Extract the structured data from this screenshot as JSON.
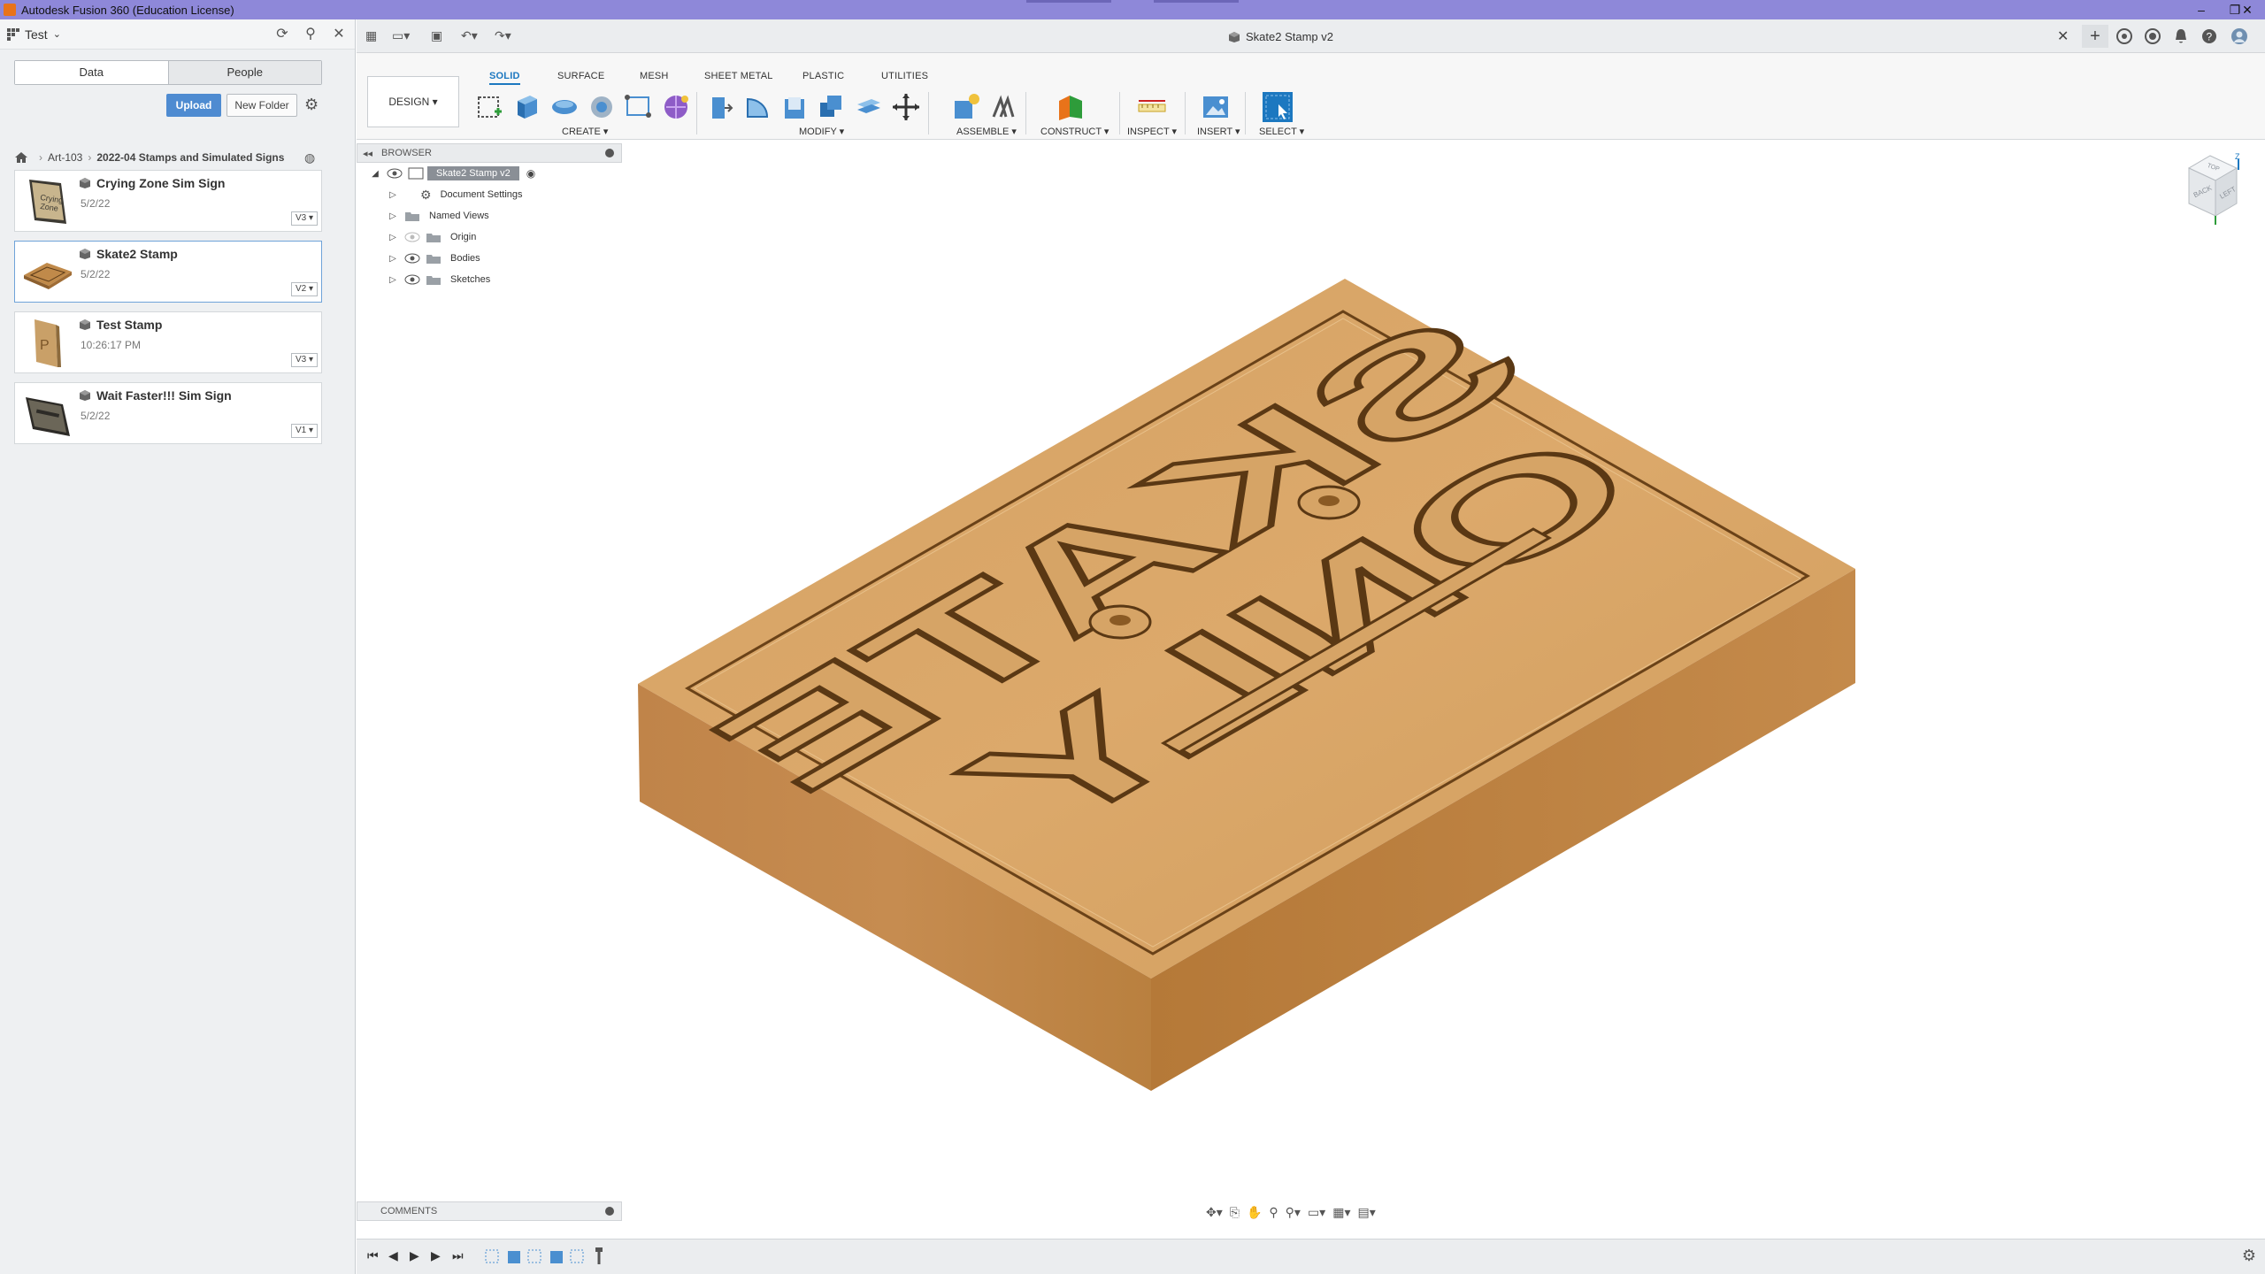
{
  "window": {
    "title": "Autodesk Fusion 360 (Education License)",
    "controls": [
      "–",
      "❐",
      "✕"
    ]
  },
  "data_panel": {
    "project": "Test",
    "tabs": {
      "data": "Data",
      "people": "People"
    },
    "upload_label": "Upload",
    "new_folder_label": "New Folder",
    "breadcrumb": [
      "Art-103",
      "2022-04 Stamps and Simulated Signs"
    ],
    "files": [
      {
        "name": "Crying Zone Sim Sign",
        "date": "5/2/22",
        "version": "V3 ▾"
      },
      {
        "name": "Skate2 Stamp",
        "date": "5/2/22",
        "version": "V2 ▾",
        "selected": true
      },
      {
        "name": "Test Stamp",
        "date": "10:26:17 PM",
        "version": "V3 ▾"
      },
      {
        "name": "Wait Faster!!! Sim Sign",
        "date": "5/2/22",
        "version": "V1 ▾"
      }
    ]
  },
  "document": {
    "tab_title": "Skate2 Stamp v2"
  },
  "ribbon": {
    "workspace": "DESIGN ▾",
    "tabs": [
      "SOLID",
      "SURFACE",
      "MESH",
      "SHEET METAL",
      "PLASTIC",
      "UTILITIES"
    ],
    "active_tab": "SOLID",
    "groups": [
      "CREATE ▾",
      "MODIFY ▾",
      "ASSEMBLE ▾",
      "CONSTRUCT ▾",
      "INSPECT ▾",
      "INSERT ▾",
      "SELECT ▾"
    ]
  },
  "browser": {
    "header": "BROWSER",
    "root": "Skate2 Stamp v2",
    "items": [
      "Document Settings",
      "Named Views",
      "Origin",
      "Bodies",
      "Sketches"
    ]
  },
  "comments_label": "COMMENTS",
  "model": {
    "embossed_text": [
      "SKATE",
      "ONLY"
    ],
    "material_color": "#d9a565"
  },
  "viewcube": {
    "front": "BACK",
    "left": "LEFT",
    "top": "TOP",
    "axis_z": "Z"
  },
  "colors": {
    "titlebar": "#8e88d9",
    "accent": "#1c78c0",
    "upload": "#4e8bd1"
  }
}
